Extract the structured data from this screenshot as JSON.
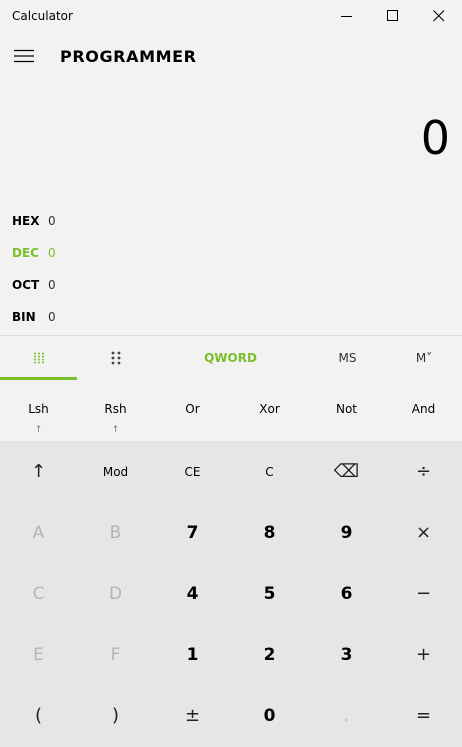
{
  "window": {
    "title": "Calculator",
    "minimize_icon": "minimize-icon",
    "maximize_icon": "maximize-icon",
    "close_icon": "close-icon"
  },
  "header": {
    "menu_icon": "hamburger-menu-icon",
    "mode": "PROGRAMMER"
  },
  "display": {
    "value": "0"
  },
  "radix": [
    {
      "label": "HEX",
      "value": "0",
      "active": false
    },
    {
      "label": "DEC",
      "value": "0",
      "active": true
    },
    {
      "label": "OCT",
      "value": "0",
      "active": false
    },
    {
      "label": "BIN",
      "value": "0",
      "active": false
    }
  ],
  "toolbar": {
    "keypad_icon": "full-keypad-icon",
    "bit_toggle_icon": "bit-toggle-keypad-icon",
    "word_size": "QWORD",
    "memory_store": "MS",
    "memory_list": "M˅"
  },
  "bitops": {
    "lsh": "Lsh",
    "rsh": "Rsh",
    "or": "Or",
    "xor": "Xor",
    "not": "Not",
    "and": "And",
    "shift_arrow": "↑"
  },
  "keys": {
    "row1": [
      "↑",
      "Mod",
      "CE",
      "C",
      "⌫",
      "÷"
    ],
    "row2": [
      "A",
      "B",
      "7",
      "8",
      "9",
      "×"
    ],
    "row3": [
      "C",
      "D",
      "4",
      "5",
      "6",
      "−"
    ],
    "row4": [
      "E",
      "F",
      "1",
      "2",
      "3",
      "+"
    ],
    "row5": [
      "(",
      ")",
      "±",
      "0",
      ".",
      "="
    ]
  },
  "colors": {
    "accent": "#7bbf2a",
    "disabled": "#b5b5b5",
    "keypad_bg": "#e6e6e6",
    "bg": "#f2f2f2"
  }
}
